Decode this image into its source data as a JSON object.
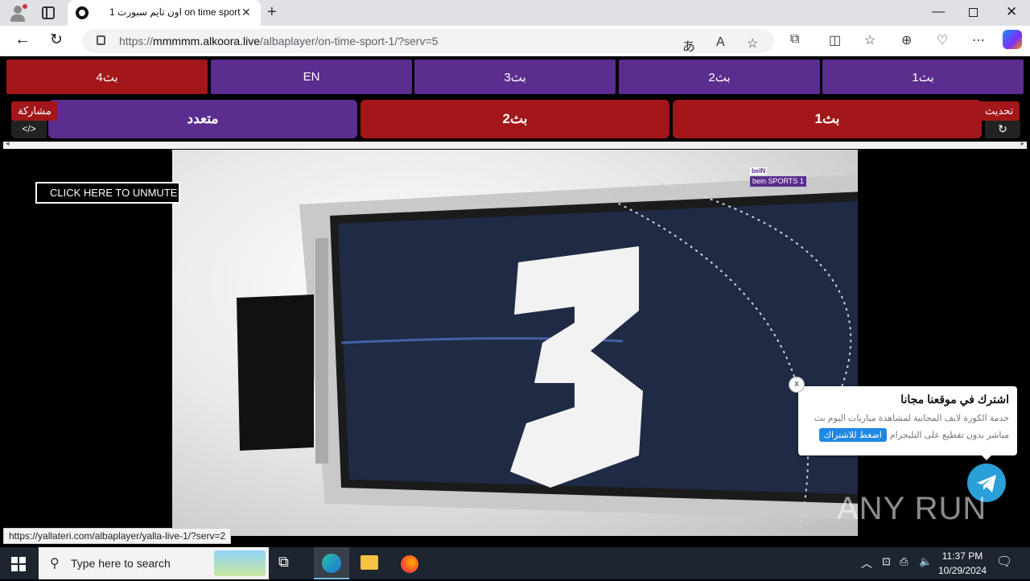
{
  "browser": {
    "tab_title": "اون تايم سبورت 1 on time sport",
    "tab_close": "✕",
    "new_tab": "+",
    "url_prefix": "https://",
    "url_host": "mmmmm.alkoora.live",
    "url_path": "/albaplayer/on-time-sport-1/?serv=5",
    "window_min": "—",
    "window_close": "✕"
  },
  "player_tabs_row1": [
    {
      "label": "بث4",
      "color": "#a3161a"
    },
    {
      "label": "EN",
      "color": "#5b2d8e"
    },
    {
      "label": "بث3",
      "color": "#5b2d8e"
    },
    {
      "label": "بث2",
      "color": "#5b2d8e"
    },
    {
      "label": "بث1",
      "color": "#5b2d8e"
    }
  ],
  "player_tabs_row2": [
    {
      "label": "متعدد",
      "color": "#5b2d8e"
    },
    {
      "label": "بث2",
      "color": "#a3161a"
    },
    {
      "label": "بث1",
      "color": "#a3161a"
    }
  ],
  "share_label": "مشاركة",
  "refresh_label": "تحديث",
  "video": {
    "unmute_label": "CLICK HERE TO UNMUTE",
    "channel_logo_top": "beIN",
    "channel_logo_bottom": "bein SPORTS 1"
  },
  "popup": {
    "title": "اشترك في موقعنا مجانا",
    "text_line1": "خدمة الكورة لايف المجانية لمشاهدة مباريات اليوم بث",
    "text_line2": "مباشر بدون تقطيع على التليجرام",
    "button": "اضغط للاشتراك",
    "close": "x"
  },
  "watermark": "ANY RUN",
  "status_url": "https://yallateri.com/albaplayer/yalla-live-1/?serv=2",
  "taskbar": {
    "search_placeholder": "Type here to search",
    "time": "11:37 PM",
    "date": "10/29/2024"
  },
  "colors": {
    "accent_purple": "#5b2d8e",
    "accent_red": "#a3161a",
    "telegram_blue": "#2a9fd8"
  }
}
